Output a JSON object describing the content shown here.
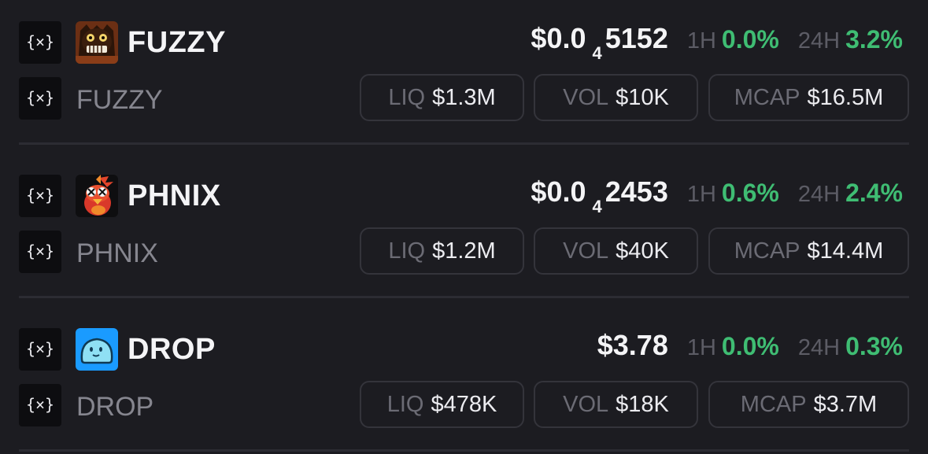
{
  "tokens": [
    {
      "symbol": "FUZZY",
      "name": "FUZZY",
      "price_main": "$0.0",
      "price_zeros": "4",
      "price_tail": "5152",
      "h1_label": "1H",
      "h1_change": "0.0%",
      "h24_label": "24H",
      "h24_change": "3.2%",
      "liq_label": "LIQ",
      "liq_value": "$1.3M",
      "vol_label": "VOL",
      "vol_value": "$10K",
      "mcap_label": "MCAP",
      "mcap_value": "$16.5M",
      "avatar_icon": "fuzzy-monster-avatar-icon"
    },
    {
      "symbol": "PHNIX",
      "name": "PHNIX",
      "price_main": "$0.0",
      "price_zeros": "4",
      "price_tail": "2453",
      "h1_label": "1H",
      "h1_change": "0.6%",
      "h24_label": "24H",
      "h24_change": "2.4%",
      "liq_label": "LIQ",
      "liq_value": "$1.2M",
      "vol_label": "VOL",
      "vol_value": "$40K",
      "mcap_label": "MCAP",
      "mcap_value": "$14.4M",
      "avatar_icon": "phoenix-bird-avatar-icon"
    },
    {
      "symbol": "DROP",
      "name": "DROP",
      "price_main": "$3.78",
      "price_zeros": "",
      "price_tail": "",
      "h1_label": "1H",
      "h1_change": "0.0%",
      "h24_label": "24H",
      "h24_change": "0.3%",
      "liq_label": "LIQ",
      "liq_value": "$478K",
      "vol_label": "VOL",
      "vol_value": "$18K",
      "mcap_label": "MCAP",
      "mcap_value": "$3.7M",
      "avatar_icon": "blue-drop-avatar-icon"
    }
  ],
  "chain_icon": "curly-brace-x-icon",
  "colors": {
    "background": "#1c1c21",
    "positive": "#3fbd73",
    "muted": "#5c5c65",
    "pill_border": "#34343b",
    "chain_icon_bg": "#0d0d10"
  }
}
